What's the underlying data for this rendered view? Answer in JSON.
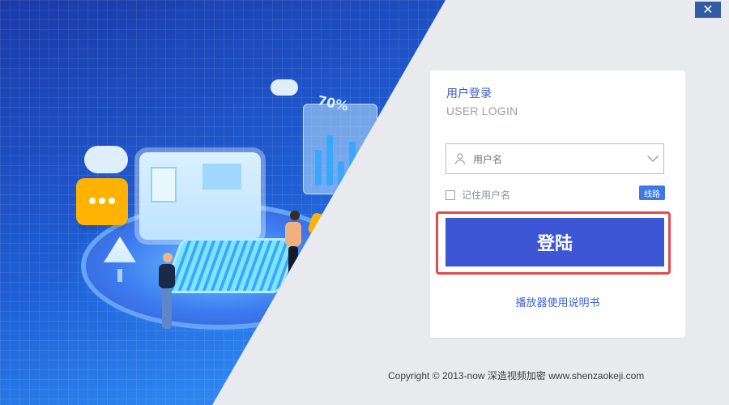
{
  "window": {
    "close_glyph": "✕"
  },
  "login": {
    "title_cn": "用户登录",
    "title_en": "USER LOGIN",
    "username_placeholder": "用户名",
    "remember_label": "记住用户名",
    "line_badge": "线路",
    "login_button": "登陆",
    "manual_link": "播放器使用说明书",
    "remember_checked": false
  },
  "illustration": {
    "percent_text": "70%"
  },
  "footer": {
    "copyright": "Copyright © 2013-now 深造视频加密 www.shenzaokeji.com"
  },
  "colors": {
    "primary": "#3d56d6",
    "link": "#3c62d7",
    "highlight": "#e04b4b",
    "line_badge": "#3c79e6"
  },
  "icons": {
    "user": "user-icon",
    "dropdown": "chevron-down-icon",
    "close": "close-icon"
  }
}
